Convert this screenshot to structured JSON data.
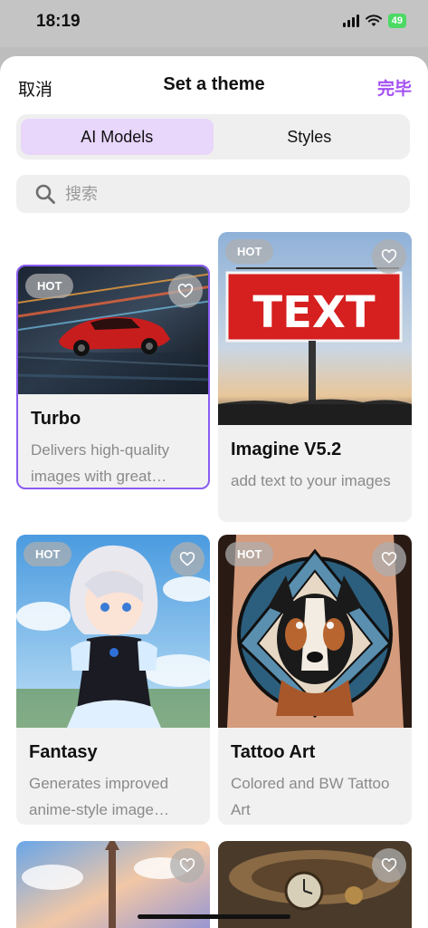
{
  "status_bar": {
    "time": "18:19",
    "battery": "49"
  },
  "nav": {
    "cancel": "取消",
    "title": "Set a theme",
    "done": "完毕"
  },
  "segments": [
    {
      "label": "AI Models",
      "active": true
    },
    {
      "label": "Styles",
      "active": false
    }
  ],
  "search": {
    "placeholder": "搜索",
    "value": ""
  },
  "colors": {
    "accent": "#a34ff2",
    "active_segment": "#e8d6fb",
    "selected_border": "#8a5cf0"
  },
  "cards": [
    {
      "badge": "HOT",
      "title": "Turbo",
      "description": "Delivers high-quality images with great…",
      "selected": true,
      "image": "red-sports-car-image"
    },
    {
      "badge": "HOT",
      "title": "Imagine V5.2",
      "description": "add text to your images",
      "selected": false,
      "image": "text-billboard-image",
      "billboard_text": "TEXT"
    },
    {
      "badge": "HOT",
      "title": "Fantasy",
      "description": "Generates improved anime-style image…",
      "selected": false,
      "image": "anime-girl-image"
    },
    {
      "badge": "HOT",
      "title": "Tattoo Art",
      "description": "Colored and BW Tattoo Art",
      "selected": false,
      "image": "dog-tattoo-image"
    },
    {
      "image": "sky-tower-image"
    },
    {
      "image": "steampunk-clock-image"
    }
  ]
}
